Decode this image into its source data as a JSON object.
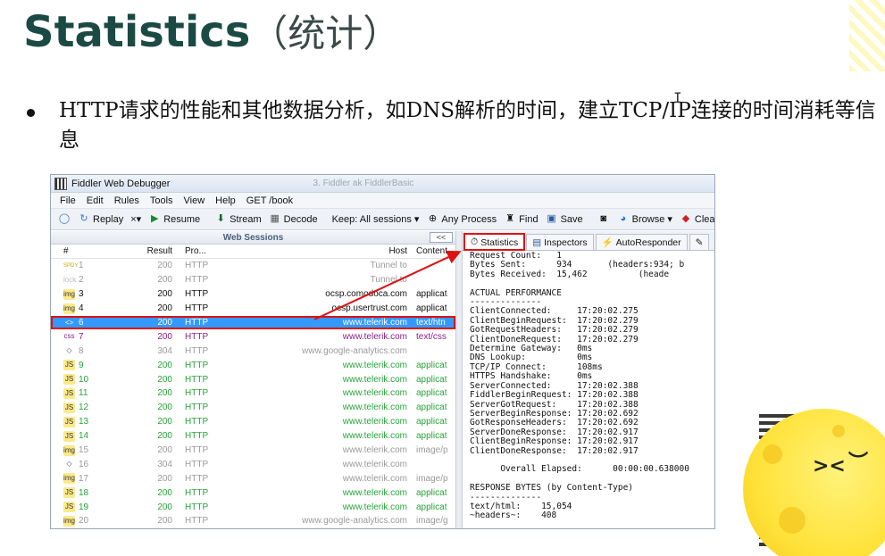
{
  "slide": {
    "title_en": "Statistics",
    "title_cn": "（统计）",
    "bullet": "HTTP请求的性能和其他数据分析，如DNS解析的时间，建立TCP/IP连接的时间消耗等信息"
  },
  "window": {
    "title": "Fiddler Web Debugger",
    "ghost_title": "3. Fiddler ak FiddlerBasic"
  },
  "menu": [
    "File",
    "Edit",
    "Rules",
    "Tools",
    "View",
    "Help",
    "GET /book"
  ],
  "toolbar": {
    "replay": "Replay",
    "remove": "×▾",
    "resume": "Resume",
    "stream": "Stream",
    "decode": "Decode",
    "keep": "Keep: All sessions ▾",
    "any_process": "Any Process",
    "find": "Find",
    "save": "Save",
    "browse": "Browse ▾",
    "clear": "Clear"
  },
  "sessions": {
    "header": "Web Sessions",
    "collapse": "<<",
    "columns": {
      "num": "#",
      "result": "Result",
      "protocol": "Pro...",
      "host": "Host",
      "content": "Content"
    },
    "rows": [
      {
        "num": "1",
        "icon": "SPDY",
        "result": "200",
        "protocol": "HTTP",
        "host": "Tunnel to",
        "content": "",
        "style": "gray"
      },
      {
        "num": "2",
        "icon": "lock",
        "result": "200",
        "protocol": "HTTP",
        "host": "Tunnel to",
        "content": "",
        "style": "gray"
      },
      {
        "num": "3",
        "icon": "img",
        "result": "200",
        "protocol": "HTTP",
        "host": "ocsp.comodoca.com",
        "content": "applicat",
        "style": "black"
      },
      {
        "num": "4",
        "icon": "img",
        "result": "200",
        "protocol": "HTTP",
        "host": "ocsp.usertrust.com",
        "content": "applicat",
        "style": "black"
      },
      {
        "num": "6",
        "icon": "<>",
        "result": "200",
        "protocol": "HTTP",
        "host": "www.telerik.com",
        "content": "text/htn",
        "style": "selected"
      },
      {
        "num": "7",
        "icon": "css",
        "result": "200",
        "protocol": "HTTP",
        "host": "www.telerik.com",
        "content": "text/css",
        "style": "purple"
      },
      {
        "num": "8",
        "icon": "◇",
        "result": "304",
        "protocol": "HTTP",
        "host": "www.google-analytics.com",
        "content": "",
        "style": "gray"
      },
      {
        "num": "9",
        "icon": "JS",
        "result": "200",
        "protocol": "HTTP",
        "host": "www.telerik.com",
        "content": "applicat",
        "style": "green"
      },
      {
        "num": "10",
        "icon": "JS",
        "result": "200",
        "protocol": "HTTP",
        "host": "www.telerik.com",
        "content": "applicat",
        "style": "green"
      },
      {
        "num": "11",
        "icon": "JS",
        "result": "200",
        "protocol": "HTTP",
        "host": "www.telerik.com",
        "content": "applicat",
        "style": "green"
      },
      {
        "num": "12",
        "icon": "JS",
        "result": "200",
        "protocol": "HTTP",
        "host": "www.telerik.com",
        "content": "applicat",
        "style": "green"
      },
      {
        "num": "13",
        "icon": "JS",
        "result": "200",
        "protocol": "HTTP",
        "host": "www.telerik.com",
        "content": "applicat",
        "style": "green"
      },
      {
        "num": "14",
        "icon": "JS",
        "result": "200",
        "protocol": "HTTP",
        "host": "www.telerik.com",
        "content": "applicat",
        "style": "green"
      },
      {
        "num": "15",
        "icon": "img",
        "result": "200",
        "protocol": "HTTP",
        "host": "www.telerik.com",
        "content": "image/p",
        "style": "gray"
      },
      {
        "num": "16",
        "icon": "◇",
        "result": "304",
        "protocol": "HTTP",
        "host": "www.telerik.com",
        "content": "",
        "style": "gray"
      },
      {
        "num": "17",
        "icon": "img",
        "result": "200",
        "protocol": "HTTP",
        "host": "www.telerik.com",
        "content": "image/p",
        "style": "gray"
      },
      {
        "num": "18",
        "icon": "JS",
        "result": "200",
        "protocol": "HTTP",
        "host": "www.telerik.com",
        "content": "applicat",
        "style": "green"
      },
      {
        "num": "19",
        "icon": "JS",
        "result": "200",
        "protocol": "HTTP",
        "host": "www.telerik.com",
        "content": "applicat",
        "style": "green"
      },
      {
        "num": "20",
        "icon": "img",
        "result": "200",
        "protocol": "HTTP",
        "host": "www.google-analytics.com",
        "content": "image/g",
        "style": "gray"
      }
    ]
  },
  "tabs": {
    "statistics": "Statistics",
    "inspectors": "Inspectors",
    "autoresponder": "AutoResponder"
  },
  "statistics_text": "Request Count:   1\nBytes Sent:      934       (headers:934; b\nBytes Received:  15,462          (heade\n\nACTUAL PERFORMANCE\n--------------\nClientConnected:     17:20:02.275\nClientBeginRequest:  17:20:02.279\nGotRequestHeaders:   17:20:02.279\nClientDoneRequest:   17:20:02.279\nDetermine Gateway:   0ms\nDNS Lookup:          0ms\nTCP/IP Connect:      108ms\nHTTPS Handshake:     0ms\nServerConnected:     17:20:02.388\nFiddlerBeginRequest: 17:20:02.388\nServerGotRequest:    17:20:02.388\nServerBeginResponse: 17:20:02.692\nGotResponseHeaders:  17:20:02.692\nServerDoneResponse:  17:20:02.917\nClientBeginResponse: 17:20:02.917\nClientDoneResponse:  17:20:02.917\n\n      Overall Elapsed:      00:00:00.638000\n\nRESPONSE BYTES (by Content-Type)\n--------------\ntext/html:    15,054\n~headers~:    408",
  "colors": {
    "title": "#1b4a45",
    "selected_row": "#3399ff",
    "highlight": "#dd1111",
    "js_green": "#27a43a",
    "moon": "#ffe23a"
  }
}
